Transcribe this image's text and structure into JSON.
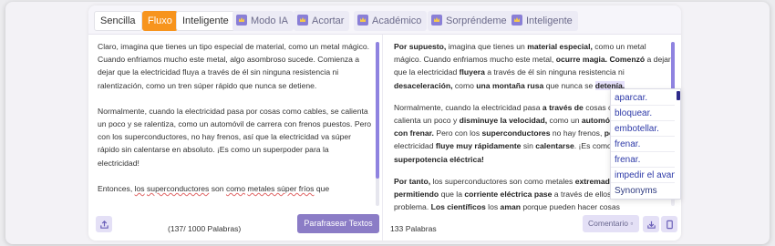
{
  "modes": [
    {
      "label": "Sencilla",
      "style": "plain"
    },
    {
      "label": "Fluxo",
      "style": "active"
    },
    {
      "label": "Inteligente",
      "style": "plain"
    },
    {
      "label": "Modo IA",
      "style": "premium"
    },
    {
      "label": "Acortar",
      "style": "premium"
    },
    {
      "label": "Académico",
      "style": "premium"
    },
    {
      "label": "Sorpréndeme",
      "style": "premium"
    },
    {
      "label": "Inteligente",
      "style": "premium"
    }
  ],
  "input": {
    "p1": "Claro, imagina que tienes un tipo especial de material, como un metal mágico. Cuando enfriamos mucho este metal, algo asombroso sucede. Comienza a dejar que la electricidad fluya a través de él sin ninguna resistencia ni ralentización, como un tren súper rápido que nunca se detiene.",
    "p2": "Normalmente, cuando la electricidad pasa por cosas como cables, se calienta un poco y se ralentiza, como un automóvil de carrera con frenos puestos. Pero con los superconductores, no hay frenos, así que la electricidad va súper rápido sin calentarse en absoluto. ¡Es como un superpoder para la electricidad!",
    "p3a": "Entonces, ",
    "p3b": "los",
    "p3c": " ",
    "p3d": "superconductores",
    "p3e": " son ",
    "p3f": "como",
    "p3g": " ",
    "p3h": "metales súper fríos",
    "p3i": " que",
    "word_count": "(137/ 1000 Palabras)",
    "paraphrase_button": "Parafrasear Textos"
  },
  "output": {
    "p1": [
      {
        "t": "Por supuesto,",
        "b": true
      },
      {
        "t": " imagina que tienes un ",
        "b": false
      },
      {
        "t": "material especial,",
        "b": true
      },
      {
        "t": " como un metal mágico. Cuando enfriamos mucho este metal, ",
        "b": false
      },
      {
        "t": "ocurre magia.",
        "b": true
      },
      {
        "t": " ",
        "b": false
      },
      {
        "t": "Comenzó",
        "b": true
      },
      {
        "t": " a dejar que la electricidad ",
        "b": false
      },
      {
        "t": "fluyera",
        "b": true
      },
      {
        "t": " a través de él sin ninguna resistencia ni ",
        "b": false
      },
      {
        "t": "desaceleración,",
        "b": true
      },
      {
        "t": " como ",
        "b": false
      },
      {
        "t": "una montaña rusa",
        "b": true
      },
      {
        "t": " que nunca se ",
        "b": false
      },
      {
        "t": "detenía.",
        "b": true,
        "hl": true
      }
    ],
    "p2": [
      {
        "t": "Normalmente, cuando la electricidad pasa ",
        "b": false
      },
      {
        "t": "a través de",
        "b": true
      },
      {
        "t": " cosas como cables, se calienta un poco y ",
        "b": false
      },
      {
        "t": "disminuye la velocidad,",
        "b": true
      },
      {
        "t": " como un ",
        "b": false
      },
      {
        "t": "automóvil de carrera con ",
        "b": true
      },
      {
        "t": "frenar.",
        "b": true
      },
      {
        "t": " Pero con los ",
        "b": false
      },
      {
        "t": "superconductores",
        "b": true
      },
      {
        "t": " no hay frenos, ",
        "b": false
      },
      {
        "t": "por lo tanto",
        "b": true
      },
      {
        "t": " la electricidad ",
        "b": false
      },
      {
        "t": "fluye muy rápidamente",
        "b": true
      },
      {
        "t": " sin ",
        "b": false
      },
      {
        "t": "calentarse",
        "b": true
      },
      {
        "t": ". ¡Es como un ",
        "b": false
      },
      {
        "t": "superpotencia eléctrica!",
        "b": true
      }
    ],
    "p3": [
      {
        "t": "Por tanto,",
        "b": true
      },
      {
        "t": " los superconductores son como metales ",
        "b": false
      },
      {
        "t": "extremadamente fríos",
        "b": true
      },
      {
        "t": " ",
        "b": false
      },
      {
        "t": "permitiendo",
        "b": true
      },
      {
        "t": " que la ",
        "b": false
      },
      {
        "t": "corriente eléctrica pase",
        "b": true
      },
      {
        "t": " a través de ellos sin ningún problema. ",
        "b": false
      },
      {
        "t": "Los científicos",
        "b": true
      },
      {
        "t": " los ",
        "b": false
      },
      {
        "t": "aman",
        "b": true
      },
      {
        "t": " porque pueden hacer cosas",
        "b": false
      }
    ],
    "word_count": "133 Palabras",
    "comment_button": "Comentario"
  },
  "synonyms": {
    "items": [
      "aparcar.",
      "bloquear.",
      "embotellar.",
      "frenar.",
      "frenar.",
      "impedir el avance"
    ],
    "footer": "Synonyms"
  },
  "colors": {
    "accent": "#8b7cc6",
    "active_mode": "#f7941d",
    "synonym_link": "#2e3aa8"
  }
}
